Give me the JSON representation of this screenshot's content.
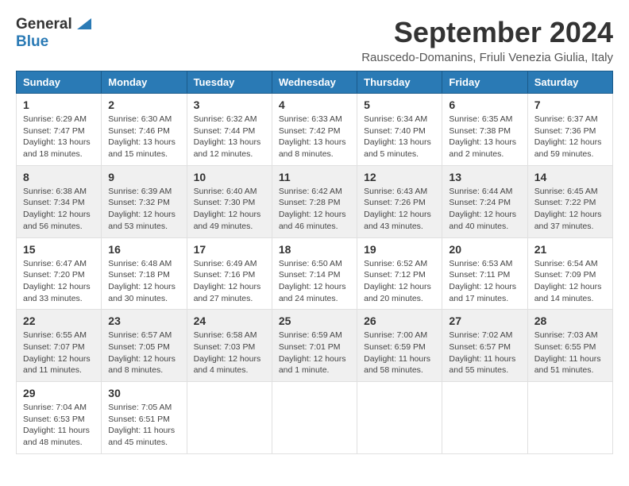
{
  "logo": {
    "line1": "General",
    "line2": "Blue"
  },
  "title": "September 2024",
  "subtitle": "Rauscedo-Domanins, Friuli Venezia Giulia, Italy",
  "weekdays": [
    "Sunday",
    "Monday",
    "Tuesday",
    "Wednesday",
    "Thursday",
    "Friday",
    "Saturday"
  ],
  "weeks": [
    [
      {
        "day": "1",
        "sunrise": "6:29 AM",
        "sunset": "7:47 PM",
        "daylight": "13 hours and 18 minutes."
      },
      {
        "day": "2",
        "sunrise": "6:30 AM",
        "sunset": "7:46 PM",
        "daylight": "13 hours and 15 minutes."
      },
      {
        "day": "3",
        "sunrise": "6:32 AM",
        "sunset": "7:44 PM",
        "daylight": "13 hours and 12 minutes."
      },
      {
        "day": "4",
        "sunrise": "6:33 AM",
        "sunset": "7:42 PM",
        "daylight": "13 hours and 8 minutes."
      },
      {
        "day": "5",
        "sunrise": "6:34 AM",
        "sunset": "7:40 PM",
        "daylight": "13 hours and 5 minutes."
      },
      {
        "day": "6",
        "sunrise": "6:35 AM",
        "sunset": "7:38 PM",
        "daylight": "13 hours and 2 minutes."
      },
      {
        "day": "7",
        "sunrise": "6:37 AM",
        "sunset": "7:36 PM",
        "daylight": "12 hours and 59 minutes."
      }
    ],
    [
      {
        "day": "8",
        "sunrise": "6:38 AM",
        "sunset": "7:34 PM",
        "daylight": "12 hours and 56 minutes."
      },
      {
        "day": "9",
        "sunrise": "6:39 AM",
        "sunset": "7:32 PM",
        "daylight": "12 hours and 53 minutes."
      },
      {
        "day": "10",
        "sunrise": "6:40 AM",
        "sunset": "7:30 PM",
        "daylight": "12 hours and 49 minutes."
      },
      {
        "day": "11",
        "sunrise": "6:42 AM",
        "sunset": "7:28 PM",
        "daylight": "12 hours and 46 minutes."
      },
      {
        "day": "12",
        "sunrise": "6:43 AM",
        "sunset": "7:26 PM",
        "daylight": "12 hours and 43 minutes."
      },
      {
        "day": "13",
        "sunrise": "6:44 AM",
        "sunset": "7:24 PM",
        "daylight": "12 hours and 40 minutes."
      },
      {
        "day": "14",
        "sunrise": "6:45 AM",
        "sunset": "7:22 PM",
        "daylight": "12 hours and 37 minutes."
      }
    ],
    [
      {
        "day": "15",
        "sunrise": "6:47 AM",
        "sunset": "7:20 PM",
        "daylight": "12 hours and 33 minutes."
      },
      {
        "day": "16",
        "sunrise": "6:48 AM",
        "sunset": "7:18 PM",
        "daylight": "12 hours and 30 minutes."
      },
      {
        "day": "17",
        "sunrise": "6:49 AM",
        "sunset": "7:16 PM",
        "daylight": "12 hours and 27 minutes."
      },
      {
        "day": "18",
        "sunrise": "6:50 AM",
        "sunset": "7:14 PM",
        "daylight": "12 hours and 24 minutes."
      },
      {
        "day": "19",
        "sunrise": "6:52 AM",
        "sunset": "7:12 PM",
        "daylight": "12 hours and 20 minutes."
      },
      {
        "day": "20",
        "sunrise": "6:53 AM",
        "sunset": "7:11 PM",
        "daylight": "12 hours and 17 minutes."
      },
      {
        "day": "21",
        "sunrise": "6:54 AM",
        "sunset": "7:09 PM",
        "daylight": "12 hours and 14 minutes."
      }
    ],
    [
      {
        "day": "22",
        "sunrise": "6:55 AM",
        "sunset": "7:07 PM",
        "daylight": "12 hours and 11 minutes."
      },
      {
        "day": "23",
        "sunrise": "6:57 AM",
        "sunset": "7:05 PM",
        "daylight": "12 hours and 8 minutes."
      },
      {
        "day": "24",
        "sunrise": "6:58 AM",
        "sunset": "7:03 PM",
        "daylight": "12 hours and 4 minutes."
      },
      {
        "day": "25",
        "sunrise": "6:59 AM",
        "sunset": "7:01 PM",
        "daylight": "12 hours and 1 minute."
      },
      {
        "day": "26",
        "sunrise": "7:00 AM",
        "sunset": "6:59 PM",
        "daylight": "11 hours and 58 minutes."
      },
      {
        "day": "27",
        "sunrise": "7:02 AM",
        "sunset": "6:57 PM",
        "daylight": "11 hours and 55 minutes."
      },
      {
        "day": "28",
        "sunrise": "7:03 AM",
        "sunset": "6:55 PM",
        "daylight": "11 hours and 51 minutes."
      }
    ],
    [
      {
        "day": "29",
        "sunrise": "7:04 AM",
        "sunset": "6:53 PM",
        "daylight": "11 hours and 48 minutes."
      },
      {
        "day": "30",
        "sunrise": "7:05 AM",
        "sunset": "6:51 PM",
        "daylight": "11 hours and 45 minutes."
      },
      null,
      null,
      null,
      null,
      null
    ]
  ]
}
